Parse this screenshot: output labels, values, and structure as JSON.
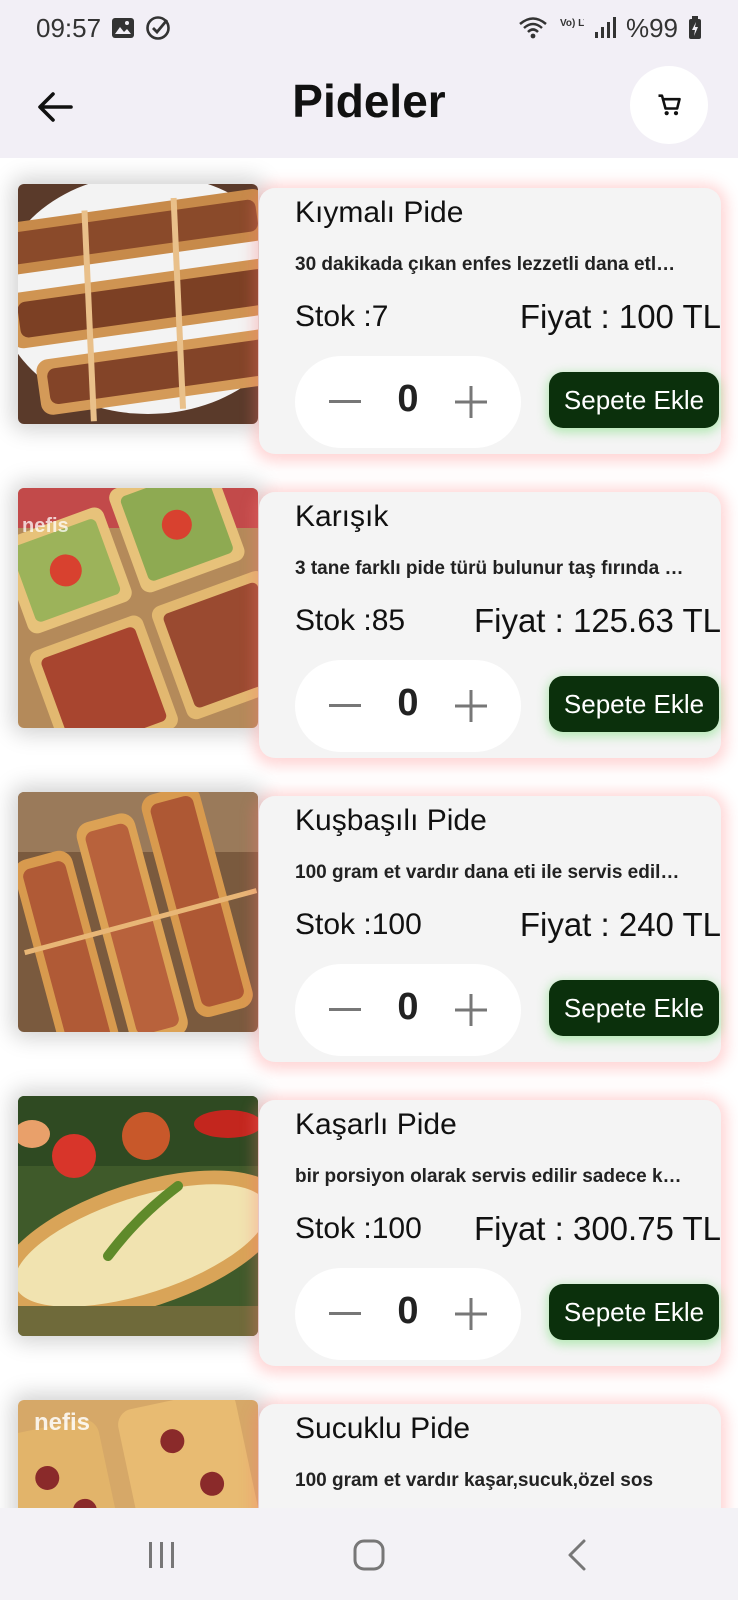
{
  "status_bar": {
    "time": "09:57",
    "icons_left": [
      "gallery-icon",
      "check-circle-icon"
    ],
    "icons_right": [
      "wifi-icon",
      "volte-lte-icon",
      "signal-icon",
      "battery-charging-icon"
    ],
    "volte_label": "Vo) LTE",
    "battery": "%99"
  },
  "app_bar": {
    "title": "Pideler",
    "back_icon": "arrow-left-icon",
    "cart_icon": "cart-icon"
  },
  "products": [
    {
      "name": "Kıymalı Pide",
      "description": "30 dakikada çıkan enfes lezzetli dana etl…",
      "stock": "Stok :7",
      "price": "Fiyat : 100 TL",
      "quantity": "0",
      "add_label": "Sepete Ekle"
    },
    {
      "name": "Karışık",
      "description": "3 tane farklı pide türü bulunur taş fırında …",
      "stock": "Stok :85",
      "price": "Fiyat : 125.63 TL",
      "quantity": "0",
      "add_label": "Sepete Ekle"
    },
    {
      "name": "Kuşbaşılı Pide",
      "description": "100 gram et vardır dana eti ile servis edil…",
      "stock": "Stok :100",
      "price": "Fiyat : 240 TL",
      "quantity": "0",
      "add_label": "Sepete Ekle"
    },
    {
      "name": "Kaşarlı Pide",
      "description": "bir porsiyon olarak servis edilir sadece k…",
      "stock": "Stok :100",
      "price": "Fiyat : 300.75 TL",
      "quantity": "0",
      "add_label": "Sepete Ekle"
    },
    {
      "name": "Sucuklu Pide",
      "description": "100 gram et vardır kaşar,sucuk,özel sos",
      "stock": "",
      "price": "",
      "quantity": "",
      "add_label": ""
    }
  ],
  "image_watermark": "nefis",
  "nav_bar": {
    "icons": [
      "recents-icon",
      "home-icon",
      "back-icon"
    ]
  },
  "colors": {
    "app_bar_bg": "#f2eff6",
    "card_bg": "#f4f4f4",
    "add_button_bg": "#0b300c",
    "card_glow": "#ff7878",
    "button_glow": "#6edc6e"
  }
}
